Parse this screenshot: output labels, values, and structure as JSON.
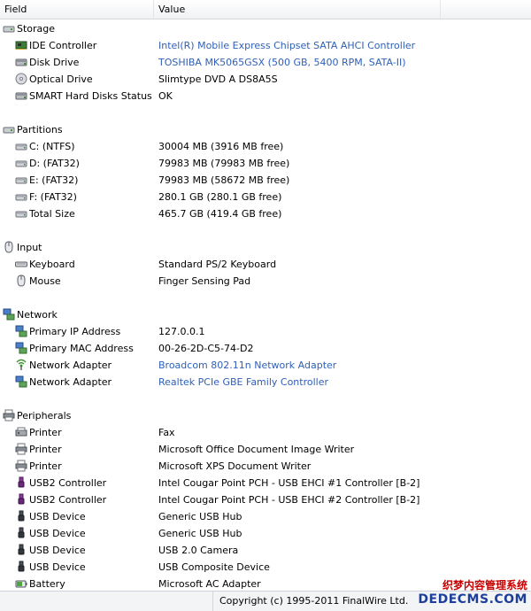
{
  "columns": {
    "field": "Field",
    "value": "Value"
  },
  "sections": [
    {
      "title": "Storage",
      "icon": "drive-icon",
      "items": [
        {
          "field": "IDE Controller",
          "value": "Intel(R) Mobile Express Chipset SATA AHCI Controller",
          "link": true,
          "icon": "controller-icon"
        },
        {
          "field": "Disk Drive",
          "value": "TOSHIBA MK5065GSX  (500 GB, 5400 RPM, SATA-II)",
          "link": true,
          "icon": "disk-drive-icon"
        },
        {
          "field": "Optical Drive",
          "value": "Slimtype DVD A  DS8A5S",
          "link": false,
          "icon": "optical-drive-icon"
        },
        {
          "field": "SMART Hard Disks Status",
          "value": "OK",
          "link": false,
          "icon": "disk-drive-icon"
        }
      ]
    },
    {
      "title": "Partitions",
      "icon": "drive-icon",
      "items": [
        {
          "field": "C: (NTFS)",
          "value": "30004 MB (3916 MB free)",
          "link": false,
          "icon": "partition-icon"
        },
        {
          "field": "D: (FAT32)",
          "value": "79983 MB (79983 MB free)",
          "link": false,
          "icon": "partition-icon"
        },
        {
          "field": "E: (FAT32)",
          "value": "79983 MB (58672 MB free)",
          "link": false,
          "icon": "partition-icon"
        },
        {
          "field": "F: (FAT32)",
          "value": "280.1 GB (280.1 GB free)",
          "link": false,
          "icon": "partition-icon"
        },
        {
          "field": "Total Size",
          "value": "465.7 GB (419.4 GB free)",
          "link": false,
          "icon": "partition-icon"
        }
      ]
    },
    {
      "title": "Input",
      "icon": "mouse-icon",
      "items": [
        {
          "field": "Keyboard",
          "value": "Standard PS/2 Keyboard",
          "link": false,
          "icon": "keyboard-icon"
        },
        {
          "field": "Mouse",
          "value": "Finger Sensing Pad",
          "link": false,
          "icon": "mouse-icon"
        }
      ]
    },
    {
      "title": "Network",
      "icon": "network-icon",
      "items": [
        {
          "field": "Primary IP Address",
          "value": "127.0.0.1",
          "link": false,
          "icon": "network-icon"
        },
        {
          "field": "Primary MAC Address",
          "value": "00-26-2D-C5-74-D2",
          "link": false,
          "icon": "network-icon"
        },
        {
          "field": "Network Adapter",
          "value": "Broadcom 802.11n Network Adapter",
          "link": true,
          "icon": "wireless-icon"
        },
        {
          "field": "Network Adapter",
          "value": "Realtek PCIe GBE Family Controller",
          "link": true,
          "icon": "network-icon"
        }
      ]
    },
    {
      "title": "Peripherals",
      "icon": "printer-icon",
      "items": [
        {
          "field": "Printer",
          "value": "Fax",
          "link": false,
          "icon": "fax-icon"
        },
        {
          "field": "Printer",
          "value": "Microsoft Office Document Image Writer",
          "link": false,
          "icon": "printer-icon"
        },
        {
          "field": "Printer",
          "value": "Microsoft XPS Document Writer",
          "link": false,
          "icon": "printer-icon"
        },
        {
          "field": "USB2 Controller",
          "value": "Intel Cougar Point PCH - USB EHCI #1 Controller [B-2]",
          "link": false,
          "icon": "usb-controller-icon"
        },
        {
          "field": "USB2 Controller",
          "value": "Intel Cougar Point PCH - USB EHCI #2 Controller [B-2]",
          "link": false,
          "icon": "usb-controller-icon"
        },
        {
          "field": "USB Device",
          "value": "Generic USB Hub",
          "link": false,
          "icon": "usb-device-icon"
        },
        {
          "field": "USB Device",
          "value": "Generic USB Hub",
          "link": false,
          "icon": "usb-device-icon"
        },
        {
          "field": "USB Device",
          "value": "USB 2.0 Camera",
          "link": false,
          "icon": "usb-device-icon"
        },
        {
          "field": "USB Device",
          "value": "USB Composite Device",
          "link": false,
          "icon": "usb-device-icon"
        },
        {
          "field": "Battery",
          "value": "Microsoft AC Adapter",
          "link": false,
          "icon": "battery-icon"
        }
      ]
    }
  ],
  "status": {
    "copyright": "Copyright (c) 1995-2011 FinalWire Ltd."
  },
  "watermark": {
    "line1": "织梦内容管理系统",
    "line2": "DEDECMS.COM"
  },
  "colors": {
    "link": "#3060b8",
    "usb_controller": "#7a2a8a"
  }
}
